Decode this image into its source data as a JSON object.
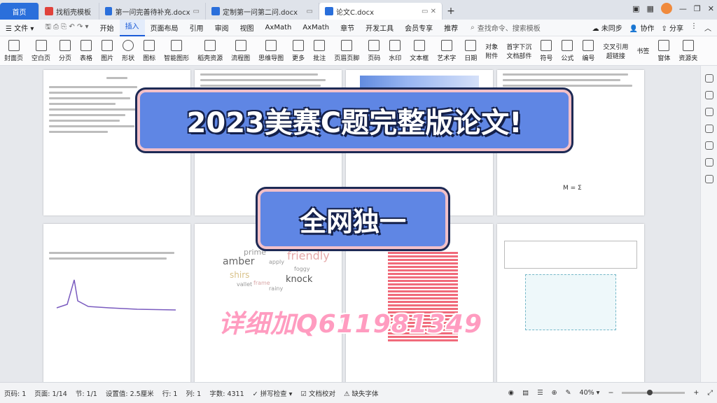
{
  "tabs": [
    {
      "label": "首页",
      "active": false
    },
    {
      "label": "找稻壳模板",
      "active": false
    },
    {
      "label": "第一问完善待补充.docx",
      "active": false
    },
    {
      "label": "定制第一问第二问.docx",
      "active": false
    },
    {
      "label": "论文C.docx",
      "active": true
    }
  ],
  "menu": {
    "file": "文件",
    "items": [
      "开始",
      "插入",
      "页面布局",
      "引用",
      "审阅",
      "视图",
      "AxMath",
      "AxMath",
      "章节",
      "开发工具",
      "会员专享",
      "推荐"
    ],
    "active": "插入",
    "search_placeholder": "查找命令、搜索模板",
    "right": [
      "未同步",
      "协作",
      "分享"
    ]
  },
  "toolbar": {
    "items": [
      "封面页",
      "空白页",
      "分页",
      "表格",
      "图片",
      "形状",
      "图标",
      "智能图形",
      "稻壳资源",
      "流程图",
      "思维导图",
      "更多",
      "批注",
      "页眉页脚",
      "页码",
      "水印",
      "文本框",
      "艺术字",
      "日期",
      "附件",
      "文档部件",
      "符号",
      "公式",
      "编号",
      "超链接",
      "书签",
      "窗体",
      "资源夹"
    ],
    "extra": [
      "对象",
      "首字下沉",
      "交叉引用"
    ]
  },
  "overlay": {
    "title": "2023美赛C题完整版论文!",
    "subtitle": "全网独一",
    "contact": "详细加Q611981349"
  },
  "wordcloud": [
    "prime",
    "friendly",
    "amber",
    "apply",
    "foggy",
    "shirs",
    "knock",
    "vallet",
    "frame",
    "rainy"
  ],
  "formula": "M = Σ",
  "status": {
    "page": "页码: 1",
    "pages": "页面: 1/14",
    "section": "节: 1/1",
    "setting": "设置值: 2.5厘米",
    "row": "行: 1",
    "col": "列: 1",
    "words": "字数: 4311",
    "spell": "拼写检查",
    "proof": "文档校对",
    "font": "缺失字体",
    "zoom": "40%"
  },
  "colors": {
    "accent": "#2a6fdb",
    "banner": "#5f86e4",
    "contact": "#ff9cc0"
  }
}
